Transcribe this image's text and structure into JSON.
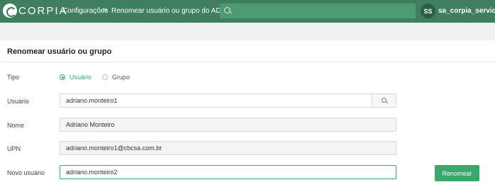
{
  "brand": {
    "logo_text": "CORPIA",
    "accent": "#3f7f5e",
    "primary": "#3aa76d"
  },
  "breadcrumb": {
    "parent": "Configurações",
    "separator": ">",
    "current": "Renomear usuário ou grupo do AD"
  },
  "search": {
    "placeholder": "",
    "icon": "search-icon"
  },
  "user": {
    "initials": "SS",
    "name": "sa_corpia_services"
  },
  "form": {
    "title": "Renomear usuário ou grupo",
    "tipo": {
      "label": "Tipo",
      "options": [
        "Usuário",
        "Grupo"
      ],
      "selected": "Usuário"
    },
    "usuario": {
      "label": "Usuário",
      "value": "adriano.monteiro1"
    },
    "nome": {
      "label": "Nome",
      "value": "Adriano Monteiro"
    },
    "upn": {
      "label": "UPN",
      "value": "adriano.monteiro1@cbcsa.com.br"
    },
    "novo_usuario": {
      "label": "Novo usuário",
      "value": "adriano.monteiro2"
    },
    "submit_label": "Renomear"
  }
}
